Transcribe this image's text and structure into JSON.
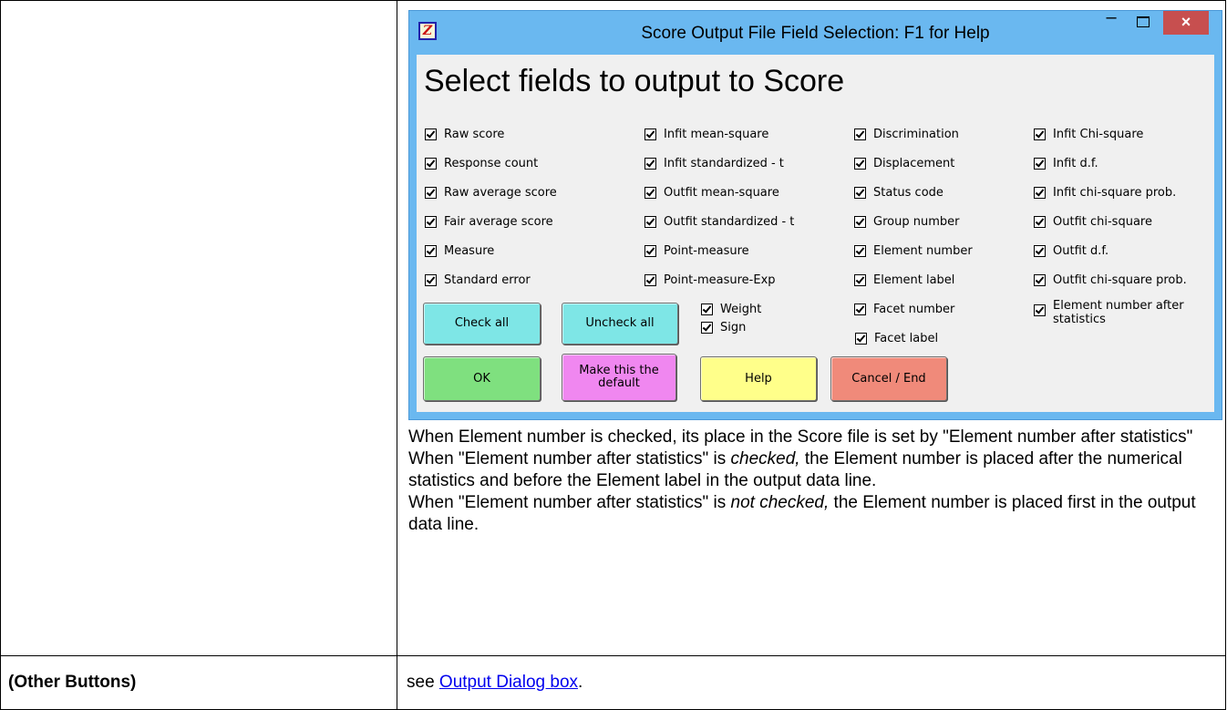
{
  "dialog": {
    "title": "Score Output File Field Selection: F1 for Help",
    "icon_glyph": "Z",
    "minimize_glyph": "–",
    "close_glyph": "×",
    "heading": "Select fields to output to Score",
    "checkboxes": {
      "col1": [
        "Raw score",
        "Response count",
        "Raw average score",
        "Fair average score",
        "Measure",
        "Standard error"
      ],
      "col2": [
        "Infit mean-square",
        "Infit standardized - t",
        "Outfit mean-square",
        "Outfit standardized - t",
        "Point-measure",
        "Point-measure-Exp"
      ],
      "col3": [
        "Discrimination",
        "Displacement",
        "Status code",
        "Group number",
        "Element number",
        "Element label",
        "Facet number",
        "Facet label"
      ],
      "col4": [
        "Infit Chi-square",
        "Infit d.f.",
        "Infit chi-square prob.",
        "Outfit chi-square",
        "Outfit d.f.",
        "Outfit chi-square prob.",
        "Element number after statistics"
      ],
      "extra": [
        "Weight",
        "Sign"
      ],
      "checked": true
    },
    "buttons": {
      "check_all": "Check all",
      "uncheck_all": "Uncheck all",
      "ok": "OK",
      "make_default": "Make this the default",
      "help": "Help",
      "cancel": "Cancel / End"
    },
    "colors": {
      "titlebar": "#6ab8f0",
      "close": "#c74f4f",
      "teal": "#7ee6e6",
      "green": "#7fe07f",
      "pink": "#f087f0",
      "yellow": "#ffff8a",
      "salmon": "#f08a7a"
    }
  },
  "description": {
    "p1": "When Element number is checked, its place in the Score file is set by \"Element number after statistics\"",
    "p2_before": "When \"Element number after statistics\" is ",
    "p2_em": "checked,",
    "p2_after": " the Element number is placed after the numerical statistics and before the Element label in the output data line.",
    "p3_before": "When \"Element number after statistics\" is ",
    "p3_em": "not checked,",
    "p3_after": " the Element number is placed first in the output data line."
  },
  "other_buttons": {
    "label": "(Other Buttons)",
    "prefix": "see ",
    "link": "Output Dialog box",
    "suffix": "."
  }
}
